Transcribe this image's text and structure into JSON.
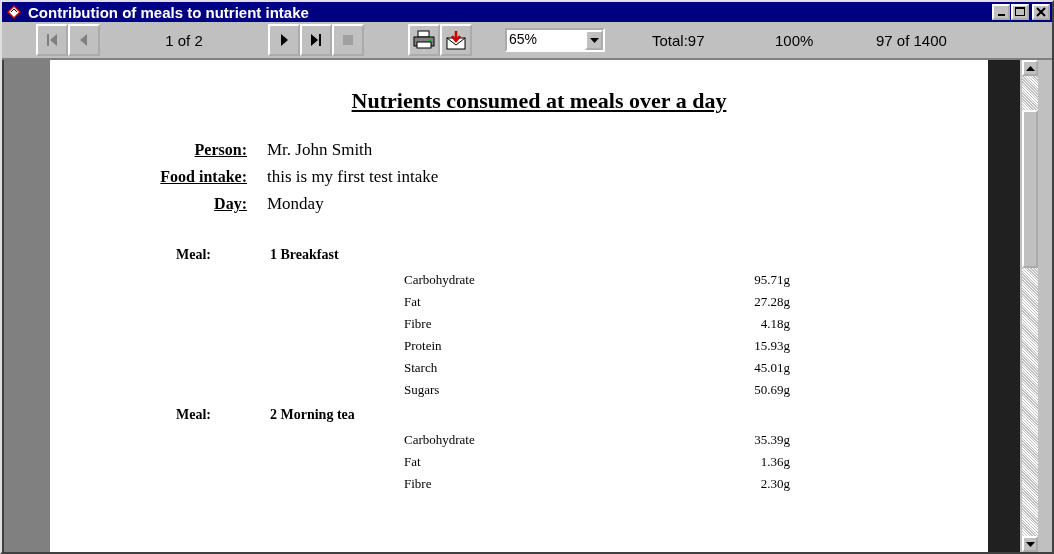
{
  "window": {
    "title": "Contribution of meals to nutrient intake"
  },
  "toolbar": {
    "nav_buttons": [
      {
        "kind": "first",
        "disabled": true
      },
      {
        "kind": "prev",
        "disabled": true
      }
    ],
    "page_indicator": "1 of 2",
    "play_buttons": [
      {
        "kind": "next",
        "disabled": false
      },
      {
        "kind": "last",
        "disabled": false
      },
      {
        "kind": "stop",
        "disabled": true
      }
    ],
    "action_buttons": [
      {
        "kind": "print"
      },
      {
        "kind": "export"
      }
    ],
    "zoom": {
      "value": "65%"
    },
    "total": "Total:97",
    "percent": "100%",
    "records": "97 of 1400"
  },
  "report": {
    "title": "Nutrients consumed at meals over a day",
    "fields": [
      {
        "label": "Person:",
        "value": "Mr. John Smith"
      },
      {
        "label": "Food intake:",
        "value": "this is my first test intake"
      },
      {
        "label": "Day:",
        "value": "Monday"
      }
    ],
    "meals": [
      {
        "label": "Meal:",
        "name": "1 Breakfast",
        "nutrients": [
          {
            "name": "Carbohydrate",
            "amount": "95.71g"
          },
          {
            "name": "Fat",
            "amount": "27.28g"
          },
          {
            "name": "Fibre",
            "amount": "4.18g"
          },
          {
            "name": "Protein",
            "amount": "15.93g"
          },
          {
            "name": "Starch",
            "amount": "45.01g"
          },
          {
            "name": "Sugars",
            "amount": "50.69g"
          }
        ]
      },
      {
        "label": "Meal:",
        "name": "2 Morning tea",
        "nutrients": [
          {
            "name": "Carbohydrate",
            "amount": "35.39g"
          },
          {
            "name": "Fat",
            "amount": "1.36g"
          },
          {
            "name": "Fibre",
            "amount": "2.30g"
          }
        ]
      }
    ]
  }
}
